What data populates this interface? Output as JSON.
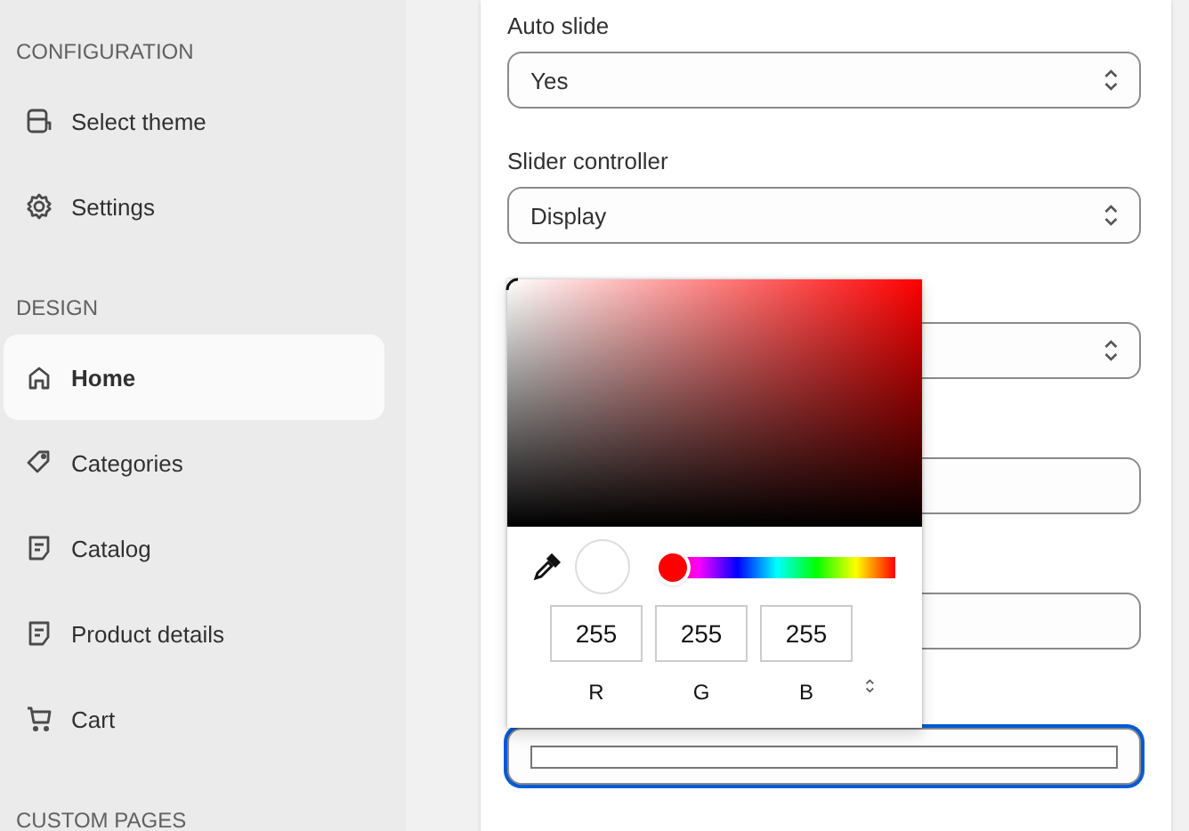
{
  "sidebar": {
    "sections": [
      {
        "heading": "CONFIGURATION",
        "items": [
          {
            "label": "Select theme",
            "selected": false
          },
          {
            "label": "Settings",
            "selected": false
          }
        ]
      },
      {
        "heading": "DESIGN",
        "items": [
          {
            "label": "Home",
            "selected": true
          },
          {
            "label": "Categories",
            "selected": false
          },
          {
            "label": "Catalog",
            "selected": false
          },
          {
            "label": "Product details",
            "selected": false
          },
          {
            "label": "Cart",
            "selected": false
          }
        ]
      },
      {
        "heading": "CUSTOM PAGES"
      }
    ]
  },
  "form": {
    "fields": [
      {
        "kind": "select",
        "label": "Auto slide",
        "value": "Yes"
      },
      {
        "kind": "select",
        "label": "Slider controller",
        "value": "Display"
      },
      {
        "kind": "select"
      },
      {
        "kind": "input"
      },
      {
        "kind": "input"
      },
      {
        "kind": "color",
        "focused": true
      }
    ]
  },
  "color_picker": {
    "hue": {
      "level": 0
    },
    "channels": [
      {
        "label": "R",
        "value": "255"
      },
      {
        "label": "G",
        "value": "255"
      },
      {
        "label": "B",
        "value": "255"
      }
    ]
  }
}
